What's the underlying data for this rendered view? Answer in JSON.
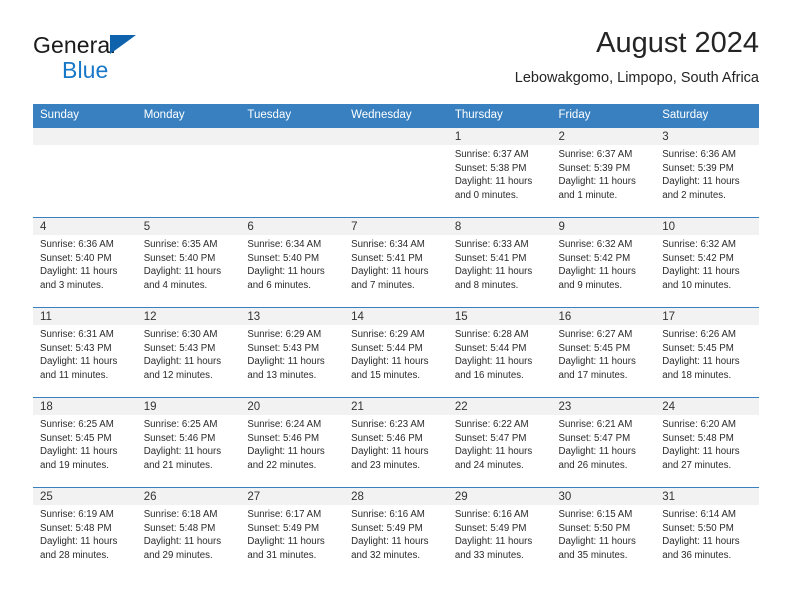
{
  "brand": {
    "name_part1": "General",
    "name_part2": "Blue",
    "triangle_color": "#0f62ac",
    "blue_color": "#1878c8"
  },
  "header": {
    "title": "August 2024",
    "subtitle": "Lebowakgomo, Limpopo, South Africa"
  },
  "theme": {
    "header_bg": "#3880c0",
    "daynum_bg": "#f2f2f2",
    "row_divider": "#3880c0",
    "text": "#2b2b2b"
  },
  "weekdays": [
    "Sunday",
    "Monday",
    "Tuesday",
    "Wednesday",
    "Thursday",
    "Friday",
    "Saturday"
  ],
  "labels": {
    "sunrise_prefix": "Sunrise:",
    "sunset_prefix": "Sunset:",
    "daylight_prefix": "Daylight:"
  },
  "weeks": [
    [
      {
        "day": "",
        "sunrise": "",
        "sunset": "",
        "daylight_line1": "",
        "daylight_line2": ""
      },
      {
        "day": "",
        "sunrise": "",
        "sunset": "",
        "daylight_line1": "",
        "daylight_line2": ""
      },
      {
        "day": "",
        "sunrise": "",
        "sunset": "",
        "daylight_line1": "",
        "daylight_line2": ""
      },
      {
        "day": "",
        "sunrise": "",
        "sunset": "",
        "daylight_line1": "",
        "daylight_line2": ""
      },
      {
        "day": "1",
        "sunrise": "Sunrise: 6:37 AM",
        "sunset": "Sunset: 5:38 PM",
        "daylight_line1": "Daylight: 11 hours",
        "daylight_line2": "and 0 minutes."
      },
      {
        "day": "2",
        "sunrise": "Sunrise: 6:37 AM",
        "sunset": "Sunset: 5:39 PM",
        "daylight_line1": "Daylight: 11 hours",
        "daylight_line2": "and 1 minute."
      },
      {
        "day": "3",
        "sunrise": "Sunrise: 6:36 AM",
        "sunset": "Sunset: 5:39 PM",
        "daylight_line1": "Daylight: 11 hours",
        "daylight_line2": "and 2 minutes."
      }
    ],
    [
      {
        "day": "4",
        "sunrise": "Sunrise: 6:36 AM",
        "sunset": "Sunset: 5:40 PM",
        "daylight_line1": "Daylight: 11 hours",
        "daylight_line2": "and 3 minutes."
      },
      {
        "day": "5",
        "sunrise": "Sunrise: 6:35 AM",
        "sunset": "Sunset: 5:40 PM",
        "daylight_line1": "Daylight: 11 hours",
        "daylight_line2": "and 4 minutes."
      },
      {
        "day": "6",
        "sunrise": "Sunrise: 6:34 AM",
        "sunset": "Sunset: 5:40 PM",
        "daylight_line1": "Daylight: 11 hours",
        "daylight_line2": "and 6 minutes."
      },
      {
        "day": "7",
        "sunrise": "Sunrise: 6:34 AM",
        "sunset": "Sunset: 5:41 PM",
        "daylight_line1": "Daylight: 11 hours",
        "daylight_line2": "and 7 minutes."
      },
      {
        "day": "8",
        "sunrise": "Sunrise: 6:33 AM",
        "sunset": "Sunset: 5:41 PM",
        "daylight_line1": "Daylight: 11 hours",
        "daylight_line2": "and 8 minutes."
      },
      {
        "day": "9",
        "sunrise": "Sunrise: 6:32 AM",
        "sunset": "Sunset: 5:42 PM",
        "daylight_line1": "Daylight: 11 hours",
        "daylight_line2": "and 9 minutes."
      },
      {
        "day": "10",
        "sunrise": "Sunrise: 6:32 AM",
        "sunset": "Sunset: 5:42 PM",
        "daylight_line1": "Daylight: 11 hours",
        "daylight_line2": "and 10 minutes."
      }
    ],
    [
      {
        "day": "11",
        "sunrise": "Sunrise: 6:31 AM",
        "sunset": "Sunset: 5:43 PM",
        "daylight_line1": "Daylight: 11 hours",
        "daylight_line2": "and 11 minutes."
      },
      {
        "day": "12",
        "sunrise": "Sunrise: 6:30 AM",
        "sunset": "Sunset: 5:43 PM",
        "daylight_line1": "Daylight: 11 hours",
        "daylight_line2": "and 12 minutes."
      },
      {
        "day": "13",
        "sunrise": "Sunrise: 6:29 AM",
        "sunset": "Sunset: 5:43 PM",
        "daylight_line1": "Daylight: 11 hours",
        "daylight_line2": "and 13 minutes."
      },
      {
        "day": "14",
        "sunrise": "Sunrise: 6:29 AM",
        "sunset": "Sunset: 5:44 PM",
        "daylight_line1": "Daylight: 11 hours",
        "daylight_line2": "and 15 minutes."
      },
      {
        "day": "15",
        "sunrise": "Sunrise: 6:28 AM",
        "sunset": "Sunset: 5:44 PM",
        "daylight_line1": "Daylight: 11 hours",
        "daylight_line2": "and 16 minutes."
      },
      {
        "day": "16",
        "sunrise": "Sunrise: 6:27 AM",
        "sunset": "Sunset: 5:45 PM",
        "daylight_line1": "Daylight: 11 hours",
        "daylight_line2": "and 17 minutes."
      },
      {
        "day": "17",
        "sunrise": "Sunrise: 6:26 AM",
        "sunset": "Sunset: 5:45 PM",
        "daylight_line1": "Daylight: 11 hours",
        "daylight_line2": "and 18 minutes."
      }
    ],
    [
      {
        "day": "18",
        "sunrise": "Sunrise: 6:25 AM",
        "sunset": "Sunset: 5:45 PM",
        "daylight_line1": "Daylight: 11 hours",
        "daylight_line2": "and 19 minutes."
      },
      {
        "day": "19",
        "sunrise": "Sunrise: 6:25 AM",
        "sunset": "Sunset: 5:46 PM",
        "daylight_line1": "Daylight: 11 hours",
        "daylight_line2": "and 21 minutes."
      },
      {
        "day": "20",
        "sunrise": "Sunrise: 6:24 AM",
        "sunset": "Sunset: 5:46 PM",
        "daylight_line1": "Daylight: 11 hours",
        "daylight_line2": "and 22 minutes."
      },
      {
        "day": "21",
        "sunrise": "Sunrise: 6:23 AM",
        "sunset": "Sunset: 5:46 PM",
        "daylight_line1": "Daylight: 11 hours",
        "daylight_line2": "and 23 minutes."
      },
      {
        "day": "22",
        "sunrise": "Sunrise: 6:22 AM",
        "sunset": "Sunset: 5:47 PM",
        "daylight_line1": "Daylight: 11 hours",
        "daylight_line2": "and 24 minutes."
      },
      {
        "day": "23",
        "sunrise": "Sunrise: 6:21 AM",
        "sunset": "Sunset: 5:47 PM",
        "daylight_line1": "Daylight: 11 hours",
        "daylight_line2": "and 26 minutes."
      },
      {
        "day": "24",
        "sunrise": "Sunrise: 6:20 AM",
        "sunset": "Sunset: 5:48 PM",
        "daylight_line1": "Daylight: 11 hours",
        "daylight_line2": "and 27 minutes."
      }
    ],
    [
      {
        "day": "25",
        "sunrise": "Sunrise: 6:19 AM",
        "sunset": "Sunset: 5:48 PM",
        "daylight_line1": "Daylight: 11 hours",
        "daylight_line2": "and 28 minutes."
      },
      {
        "day": "26",
        "sunrise": "Sunrise: 6:18 AM",
        "sunset": "Sunset: 5:48 PM",
        "daylight_line1": "Daylight: 11 hours",
        "daylight_line2": "and 29 minutes."
      },
      {
        "day": "27",
        "sunrise": "Sunrise: 6:17 AM",
        "sunset": "Sunset: 5:49 PM",
        "daylight_line1": "Daylight: 11 hours",
        "daylight_line2": "and 31 minutes."
      },
      {
        "day": "28",
        "sunrise": "Sunrise: 6:16 AM",
        "sunset": "Sunset: 5:49 PM",
        "daylight_line1": "Daylight: 11 hours",
        "daylight_line2": "and 32 minutes."
      },
      {
        "day": "29",
        "sunrise": "Sunrise: 6:16 AM",
        "sunset": "Sunset: 5:49 PM",
        "daylight_line1": "Daylight: 11 hours",
        "daylight_line2": "and 33 minutes."
      },
      {
        "day": "30",
        "sunrise": "Sunrise: 6:15 AM",
        "sunset": "Sunset: 5:50 PM",
        "daylight_line1": "Daylight: 11 hours",
        "daylight_line2": "and 35 minutes."
      },
      {
        "day": "31",
        "sunrise": "Sunrise: 6:14 AM",
        "sunset": "Sunset: 5:50 PM",
        "daylight_line1": "Daylight: 11 hours",
        "daylight_line2": "and 36 minutes."
      }
    ]
  ]
}
